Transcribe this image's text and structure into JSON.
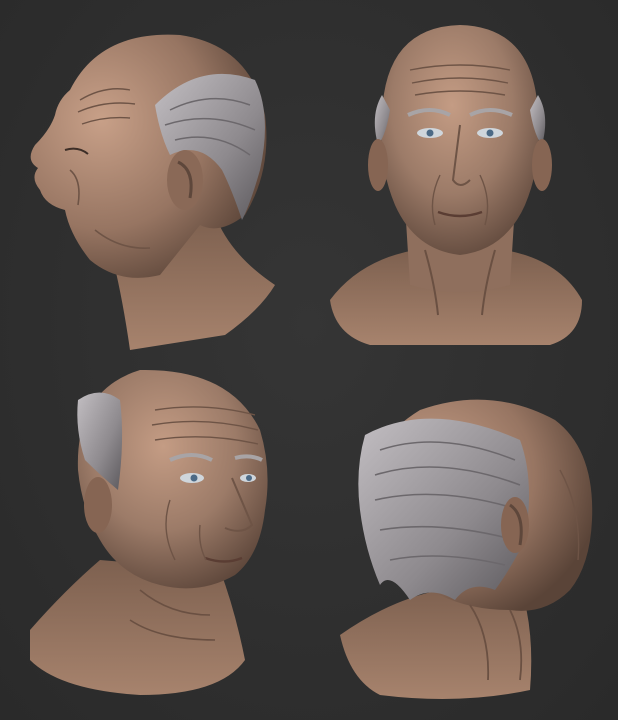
{
  "scene": {
    "background_color": "#2e2e2e",
    "skin_color": "#9c7b68",
    "skin_shadow_color": "#6e5446",
    "skin_highlight_color": "#c49c84",
    "hair_color": "#9a9699",
    "hair_shadow_color": "#5f5c60",
    "views": [
      {
        "id": "side-left",
        "subject": "elderly-man-head-left-profile"
      },
      {
        "id": "front",
        "subject": "elderly-man-head-front"
      },
      {
        "id": "three-quarter",
        "subject": "elderly-man-head-three-quarter-right"
      },
      {
        "id": "back-right",
        "subject": "elderly-man-head-back-right"
      }
    ]
  }
}
